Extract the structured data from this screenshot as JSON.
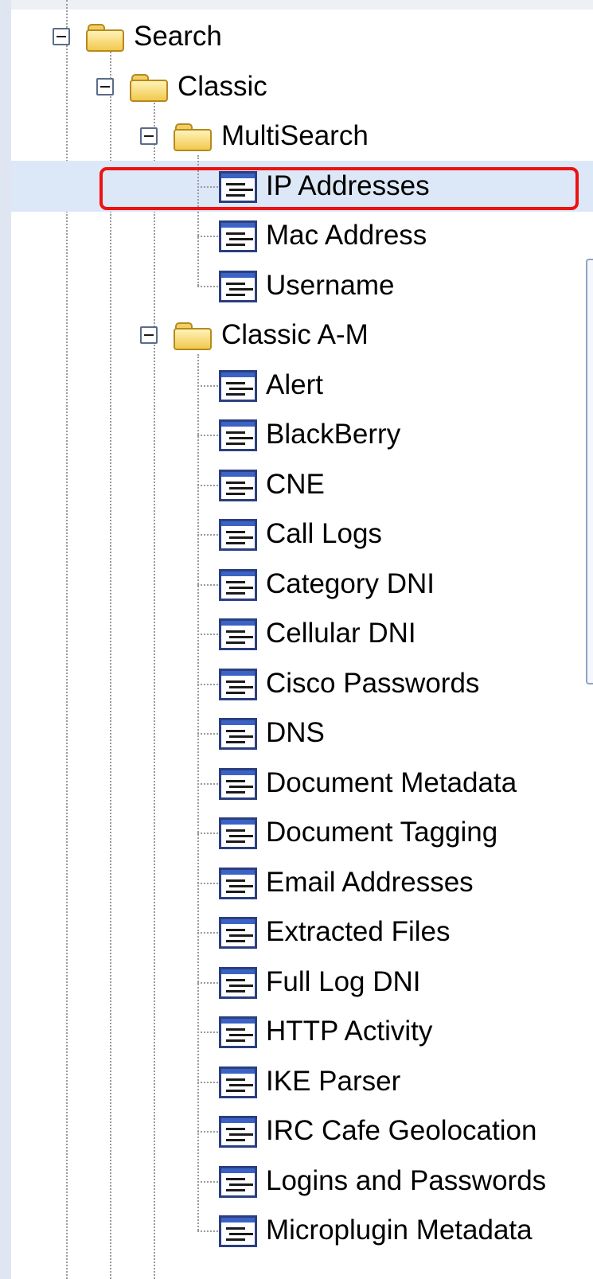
{
  "tree": {
    "root": {
      "label": "Search",
      "expanded": true
    },
    "classic": {
      "label": "Classic",
      "expanded": true
    },
    "groups": [
      {
        "label": "MultiSearch",
        "expanded": true,
        "items": [
          {
            "label": "IP Addresses",
            "selected": true
          },
          {
            "label": "Mac Address"
          },
          {
            "label": "Username"
          }
        ]
      },
      {
        "label": "Classic A-M",
        "expanded": true,
        "items": [
          {
            "label": "Alert"
          },
          {
            "label": "BlackBerry"
          },
          {
            "label": "CNE"
          },
          {
            "label": "Call Logs"
          },
          {
            "label": "Category DNI"
          },
          {
            "label": "Cellular DNI"
          },
          {
            "label": "Cisco Passwords"
          },
          {
            "label": "DNS"
          },
          {
            "label": "Document Metadata"
          },
          {
            "label": "Document Tagging"
          },
          {
            "label": "Email Addresses"
          },
          {
            "label": "Extracted Files"
          },
          {
            "label": "Full Log DNI"
          },
          {
            "label": "HTTP Activity"
          },
          {
            "label": "IKE Parser"
          },
          {
            "label": "IRC Cafe Geolocation"
          },
          {
            "label": "Logins and Passwords"
          },
          {
            "label": "Microplugin Metadata"
          }
        ]
      }
    ],
    "icons": {
      "toggle": "collapse-minus-icon",
      "folder": "folder-open-icon",
      "item": "form-document-icon"
    },
    "colors": {
      "selection_fill": "#dce7f7",
      "highlight_outline": "#ee1111",
      "doc_icon_blue": "#3b63c6",
      "folder_yellow": "#f2c94f"
    }
  }
}
